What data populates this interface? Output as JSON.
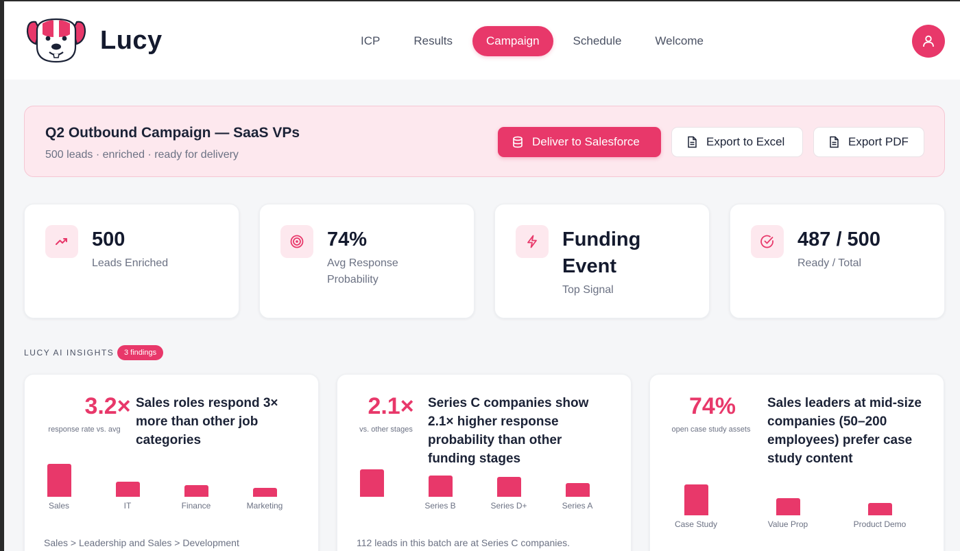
{
  "app": {
    "name": "Lucy"
  },
  "nav": {
    "items": [
      {
        "label": "ICP",
        "active": false
      },
      {
        "label": "Results",
        "active": false
      },
      {
        "label": "Campaign",
        "active": true
      },
      {
        "label": "Schedule",
        "active": false
      },
      {
        "label": "Welcome",
        "active": false
      }
    ]
  },
  "user": {
    "icon": "user-icon"
  },
  "campaign": {
    "title": "Q2 Outbound Campaign — SaaS VPs",
    "subtitle": "500 leads · enriched · ready for delivery",
    "actions": {
      "deliver_label": "Deliver to Salesforce",
      "deliver_icon": "database-icon",
      "excel_label": "Export to Excel",
      "excel_icon": "file-icon",
      "pdf_label": "Export PDF",
      "pdf_icon": "file-icon"
    }
  },
  "stats": [
    {
      "value": "500",
      "label": "Leads Enriched",
      "icon": "trending-up-icon"
    },
    {
      "value": "74%",
      "label": "Avg Response Probability",
      "icon": "target-icon"
    },
    {
      "value": "Funding Event",
      "label": "Top Signal",
      "icon": "lightning-icon"
    },
    {
      "value": "487 / 500",
      "label": "Ready / Total",
      "icon": "check-circle-icon"
    }
  ],
  "insights": {
    "label": "LUCY AI INSIGHTS",
    "badge": "3 findings",
    "cards": [
      {
        "metric": "3.2×",
        "metric_caption": "response rate vs. avg",
        "headline": "Sales roles respond 3× more than other job categories",
        "bars": [
          {
            "label": "Sales",
            "value": 1.0
          },
          {
            "label": "IT",
            "value": 0.45
          },
          {
            "label": "Finance",
            "value": 0.35
          },
          {
            "label": "Marketing",
            "value": 0.28
          }
        ],
        "footnote": "Sales > Leadership and Sales > Development"
      },
      {
        "metric": "2.1×",
        "metric_caption": "vs. other stages",
        "headline": "Series C companies show 2.1× higher response probability than other funding stages",
        "bars": [
          {
            "label": "",
            "value": 1.0
          },
          {
            "label": "Series B",
            "value": 0.78
          },
          {
            "label": "Series D+",
            "value": 0.72
          },
          {
            "label": "Series A",
            "value": 0.5
          }
        ],
        "footnote": "112 leads in this batch are at Series C companies."
      },
      {
        "metric": "74%",
        "metric_caption": "open case study assets",
        "headline": "Sales leaders at mid-size companies (50–200 employees) prefer case study content",
        "bars": [
          {
            "label": "Case Study",
            "value": 1.0
          },
          {
            "label": "Value Prop",
            "value": 0.55
          },
          {
            "label": "Product Demo",
            "value": 0.4
          }
        ],
        "footnote": ""
      }
    ]
  },
  "colors": {
    "accent": "#e8386a",
    "accent_soft": "#fde8ee",
    "text": "#1b2236",
    "muted": "#6b7183"
  }
}
